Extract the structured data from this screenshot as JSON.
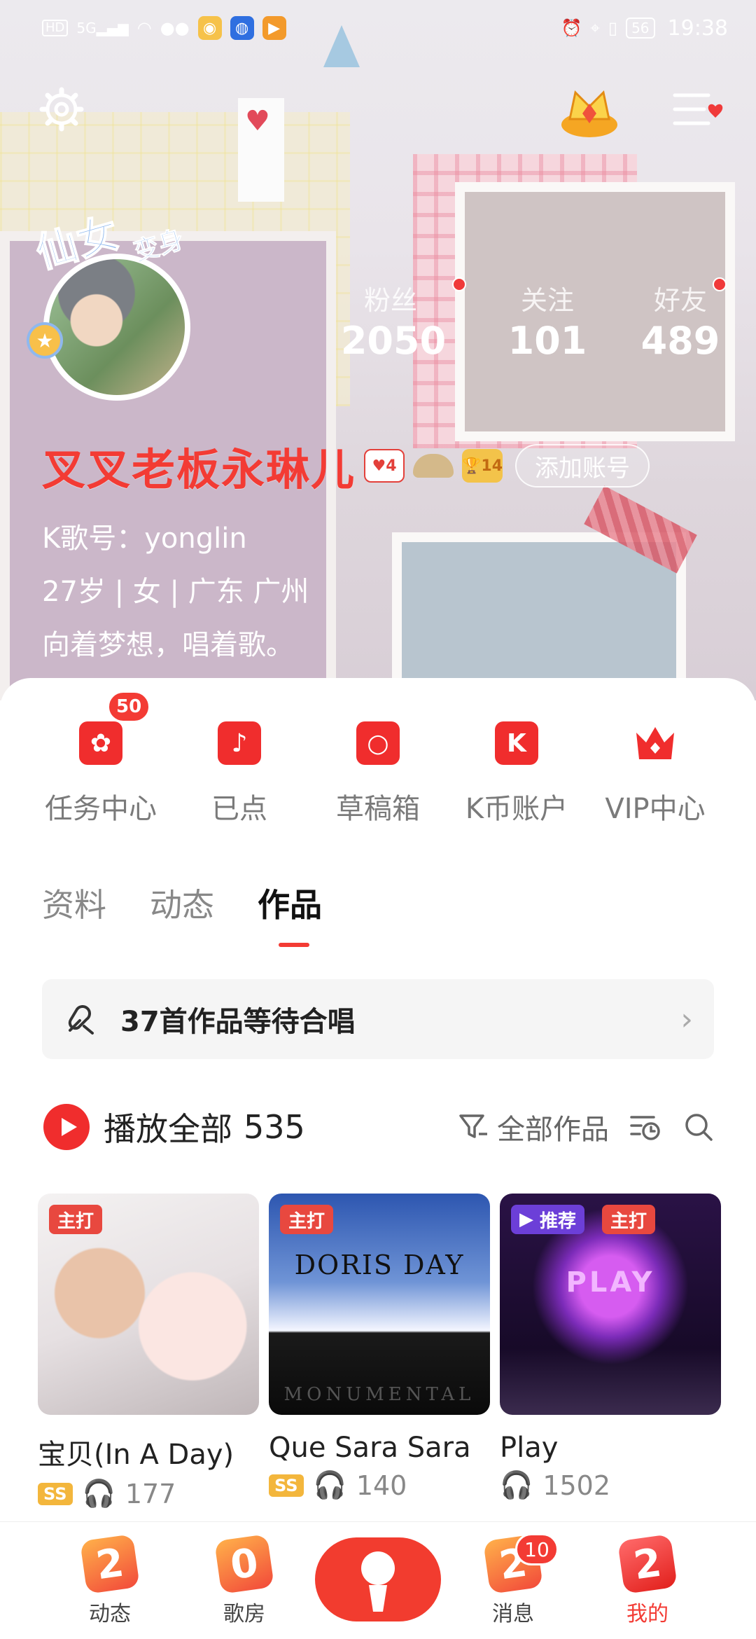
{
  "status_bar": {
    "hd": "HD",
    "signal": "5G",
    "battery": "56",
    "time": "19:38"
  },
  "profile": {
    "avatar_frame_text": "仙女",
    "avatar_frame_small": "变身",
    "stats": [
      {
        "label": "粉丝",
        "value": "2050",
        "dot": true
      },
      {
        "label": "关注",
        "value": "101",
        "dot": false
      },
      {
        "label": "好友",
        "value": "489",
        "dot": true
      }
    ],
    "name": "叉叉老板永琳儿",
    "badges": [
      {
        "icon": "heart-level-icon",
        "text": "4"
      },
      {
        "icon": "hat-icon",
        "text": ""
      },
      {
        "icon": "trophy-icon",
        "text": "14"
      }
    ],
    "add_account": "添加账号",
    "k_id": "K歌号：yonglin",
    "info": "27岁 | 女 | 广东 广州",
    "bio": "向着梦想，唱着歌。"
  },
  "quick_actions": [
    {
      "label": "任务中心",
      "icon": "task-icon",
      "glyph": "✿",
      "badge": "50"
    },
    {
      "label": "已点",
      "icon": "music-note-icon",
      "glyph": "♪",
      "badge": ""
    },
    {
      "label": "草稿箱",
      "icon": "draft-icon",
      "glyph": "○",
      "badge": ""
    },
    {
      "label": "K币账户",
      "icon": "k-coin-icon",
      "glyph": "K",
      "badge": ""
    },
    {
      "label": "VIP中心",
      "icon": "vip-crown-icon",
      "glyph": "♛",
      "badge": ""
    }
  ],
  "tabs": [
    {
      "label": "资料",
      "active": false
    },
    {
      "label": "动态",
      "active": false
    },
    {
      "label": "作品",
      "active": true
    }
  ],
  "duet_banner": "37首作品等待合唱",
  "play_all": {
    "label": "播放全部",
    "count": "535",
    "filter_label": "全部作品"
  },
  "songs": [
    {
      "title": "宝贝(In A Day)",
      "tags": [
        {
          "text": "主打",
          "style": "red"
        }
      ],
      "quality": "SS",
      "plays": "177",
      "cover": "girl-with-plush-cover"
    },
    {
      "title": "Que Sara Sara",
      "tags": [
        {
          "text": "主打",
          "style": "red"
        }
      ],
      "quality": "SS",
      "plays": "140",
      "cover": "doris-day-cover",
      "cover_title": "DORIS DAY",
      "cover_sub": "MONUMENTAL"
    },
    {
      "title": "Play",
      "tags": [
        {
          "text": "推荐",
          "style": "purple"
        },
        {
          "text": "主打",
          "style": "red"
        }
      ],
      "quality": "",
      "plays": "1502",
      "cover": "retro-computer-cover",
      "cover_title": "PLAY"
    }
  ],
  "bottom_nav": [
    {
      "label": "动态",
      "glyph": "2",
      "active": false
    },
    {
      "label": "歌房",
      "glyph": "0",
      "active": false
    },
    {
      "label": "消息",
      "glyph": "2",
      "active": false,
      "badge": "10"
    },
    {
      "label": "我的",
      "glyph": "2",
      "active": true
    }
  ],
  "colors": {
    "accent": "#f33b34",
    "vip": "#f02d2d",
    "quality_badge": "#f3b63c",
    "recommend_tag": "#6c3fd8"
  }
}
